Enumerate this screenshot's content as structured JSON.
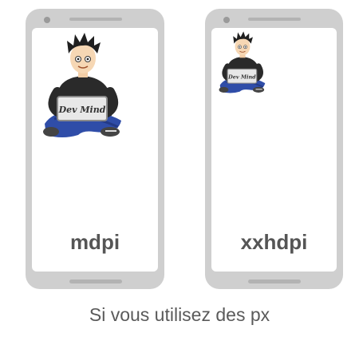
{
  "phones": [
    {
      "density_label": "mdpi",
      "mascot_text": "Dev Mind"
    },
    {
      "density_label": "xxhdpi",
      "mascot_text": "Dev Mind"
    }
  ],
  "caption": "Si vous utilisez des px",
  "colors": {
    "phone_body": "#cfcfcf",
    "screen": "#ffffff",
    "label_text": "#555555",
    "caption_text": "#5a5a5a"
  },
  "icons": {
    "mascot": "dev-mind-mascot-illustration"
  }
}
